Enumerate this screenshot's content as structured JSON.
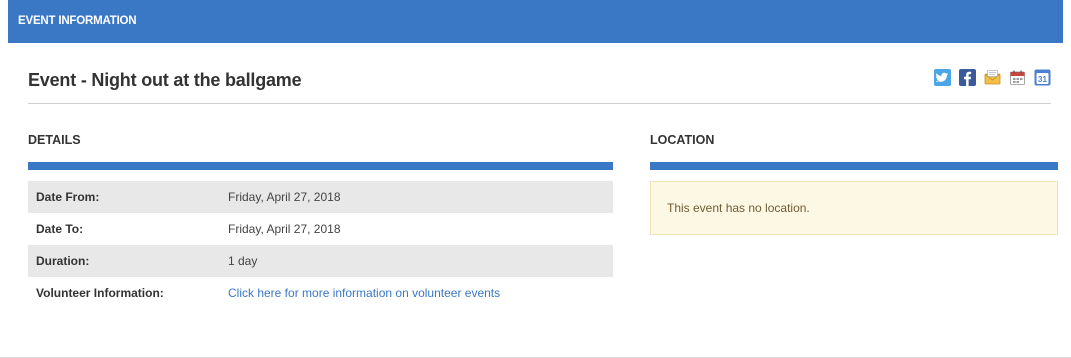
{
  "header": {
    "title": "EVENT INFORMATION"
  },
  "event": {
    "title": "Event - Night out at the ballgame"
  },
  "share": {
    "icons": [
      "twitter-icon",
      "facebook-icon",
      "email-icon",
      "calendar-icon",
      "google-calendar-icon"
    ],
    "google_calendar_day": "31"
  },
  "details": {
    "heading": "DETAILS",
    "rows": [
      {
        "label": "Date From:",
        "value": "Friday, April 27, 2018"
      },
      {
        "label": "Date To:",
        "value": "Friday, April 27, 2018"
      },
      {
        "label": "Duration:",
        "value": "1 day"
      },
      {
        "label": "Volunteer Information:",
        "value": "Click here for more information on volunteer events"
      }
    ]
  },
  "location": {
    "heading": "LOCATION",
    "notice": "This event has no location."
  },
  "colors": {
    "accent": "#3a78c6",
    "row_shade": "#e8e8e8",
    "notice_bg": "#fcf8e3",
    "notice_border": "#ece3b8",
    "link": "#3a78c6"
  }
}
